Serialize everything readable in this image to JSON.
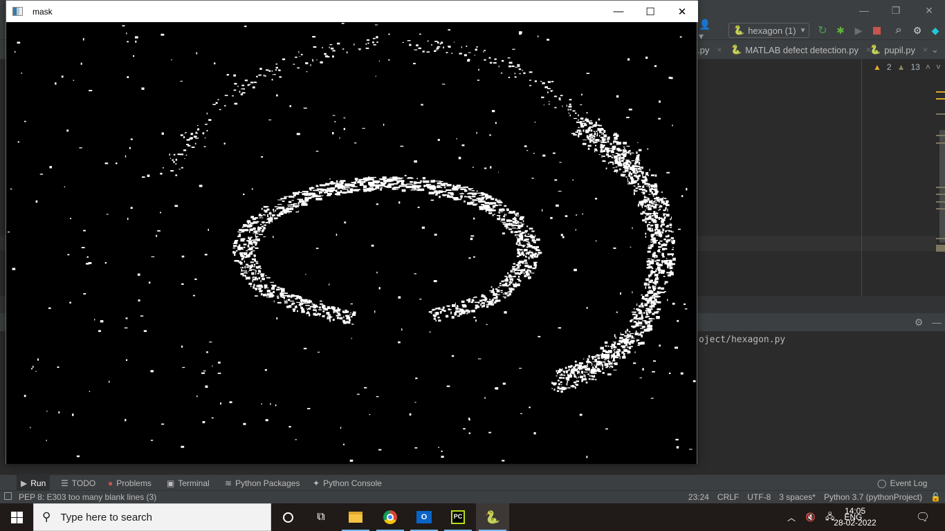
{
  "ide": {
    "run_config": "hexagon (1)",
    "editor_tabs": [
      {
        "label": ".py",
        "close": "×"
      },
      {
        "label": "MATLAB defect detection.py",
        "close": "×"
      },
      {
        "label": "pupil.py",
        "close": "×"
      }
    ],
    "inspections": {
      "warnings": "2",
      "weak_warnings": "13"
    },
    "console_line": "oject/hexagon.py",
    "tool_windows": [
      {
        "label": "Run",
        "icon": "play-icon"
      },
      {
        "label": "TODO",
        "icon": "list-icon"
      },
      {
        "label": "Problems",
        "icon": "error-icon"
      },
      {
        "label": "Terminal",
        "icon": "terminal-icon"
      },
      {
        "label": "Python Packages",
        "icon": "layers-icon"
      },
      {
        "label": "Python Console",
        "icon": "python-icon"
      }
    ],
    "event_log": "Event Log",
    "status": {
      "message": "PEP 8: E303 too many blank lines (3)",
      "position": "23:24",
      "line_sep": "CRLF",
      "encoding": "UTF-8",
      "indent": "3 spaces*",
      "interpreter": "Python 3.7 (pythonProject)"
    },
    "colors": {
      "warning": "#e2a92a",
      "stop": "#c75450",
      "run": "#499c54",
      "debug": "#5fb43b"
    }
  },
  "mask_window": {
    "title": "mask",
    "minimize": "—",
    "maximize": "☐",
    "close": "✕"
  },
  "taskbar": {
    "search_placeholder": "Type here to search",
    "apps": [
      "Cortana",
      "Task View",
      "File Explorer",
      "Google Chrome",
      "Outlook",
      "PyCharm",
      "Python"
    ],
    "language": "ENG",
    "time": "14:05",
    "date": "28-02-2022"
  }
}
